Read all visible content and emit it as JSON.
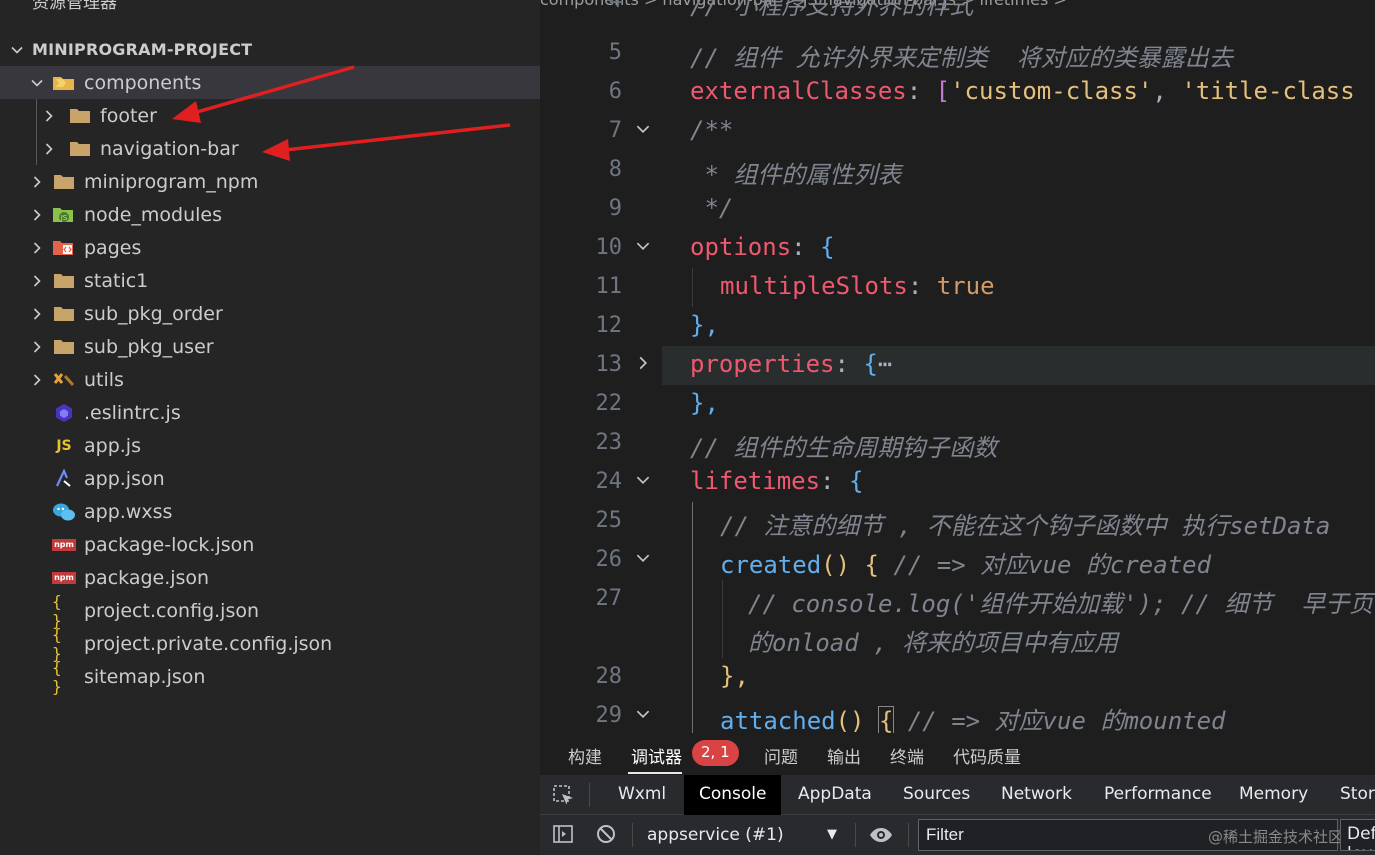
{
  "explorer": {
    "title": "资源管理器",
    "more": "···",
    "root": "MINIPROGRAM-PROJECT",
    "items": [
      {
        "label": "components",
        "icon": "components-folder-icon"
      },
      {
        "label": "footer",
        "icon": "folder-icon"
      },
      {
        "label": "navigation-bar",
        "icon": "folder-icon"
      },
      {
        "label": "miniprogram_npm",
        "icon": "folder-icon"
      },
      {
        "label": "node_modules",
        "icon": "node-folder-icon"
      },
      {
        "label": "pages",
        "icon": "pages-folder-icon"
      },
      {
        "label": "static1",
        "icon": "folder-icon"
      },
      {
        "label": "sub_pkg_order",
        "icon": "folder-icon"
      },
      {
        "label": "sub_pkg_user",
        "icon": "folder-icon"
      },
      {
        "label": "utils",
        "icon": "utils-folder-icon"
      },
      {
        "label": ".eslintrc.js",
        "icon": "eslint-icon"
      },
      {
        "label": "app.js",
        "icon": "js-icon",
        "badge": "JS"
      },
      {
        "label": "app.json",
        "icon": "app-json-icon"
      },
      {
        "label": "app.wxss",
        "icon": "wxss-icon"
      },
      {
        "label": "package-lock.json",
        "icon": "npm-icon",
        "badge": "npm"
      },
      {
        "label": "package.json",
        "icon": "npm-icon",
        "badge": "npm"
      },
      {
        "label": "project.config.json",
        "icon": "json-icon",
        "badge": "{ }"
      },
      {
        "label": "project.private.config.json",
        "icon": "json-icon",
        "badge": "{ }"
      },
      {
        "label": "sitemap.json",
        "icon": "json-icon",
        "badge": "{ }"
      }
    ]
  },
  "editor": {
    "breadcrumb": "components > navigation-bar > JS navigation-bar.js > lifetimes > ",
    "lines": {
      "l4": {
        "num": "4",
        "comment": "// 小程序支持外界的样式"
      },
      "l5": {
        "num": "5",
        "comment": "// 组件 允许外界来定制类  将对应的类暴露出去"
      },
      "l6": {
        "num": "6",
        "key": "externalClasses",
        "colon": ":",
        "open": "[",
        "s1": "'custom-class'",
        "comma": ",",
        "s2": "'title-class"
      },
      "l7": {
        "num": "7",
        "comment": "/**"
      },
      "l8": {
        "num": "8",
        "comment": " * 组件的属性列表"
      },
      "l9": {
        "num": "9",
        "comment": " */"
      },
      "l10": {
        "num": "10",
        "key": "options",
        "colon": ":",
        "open": "{"
      },
      "l11": {
        "num": "11",
        "key": "multipleSlots",
        "colon": ":",
        "value": "true"
      },
      "l12": {
        "num": "12",
        "close": "},"
      },
      "l13": {
        "num": "13",
        "key": "properties",
        "colon": ":",
        "open": "{",
        "ellipsis": "⋯"
      },
      "l22": {
        "num": "22",
        "close": "},"
      },
      "l23": {
        "num": "23",
        "comment": "// 组件的生命周期钩子函数"
      },
      "l24": {
        "num": "24",
        "key": "lifetimes",
        "colon": ":",
        "open": "{"
      },
      "l25": {
        "num": "25",
        "comment": "// 注意的细节 , 不能在这个钩子函数中 执行setData"
      },
      "l26": {
        "num": "26",
        "fn": "created",
        "parens": "()",
        "open": "{",
        "comment": "// => 对应vue 的created"
      },
      "l27": {
        "num": "27",
        "comment": "// console.log('组件开始加载'); // 细节  早于页面",
        "comment2": "的onload , 将来的项目中有应用"
      },
      "l28": {
        "num": "28",
        "close": "},"
      },
      "l29": {
        "num": "29",
        "fn": "attached",
        "parens": "()",
        "open": "{",
        "comment": "// => 对应vue 的mounted"
      }
    }
  },
  "panel": {
    "tabs": [
      "构建",
      "调试器",
      "问题",
      "输出",
      "终端",
      "代码质量"
    ],
    "badge": "2, 1",
    "devtools_tabs": [
      "Wxml",
      "Console",
      "AppData",
      "Sources",
      "Network",
      "Performance",
      "Memory",
      "Storage"
    ],
    "context": "appservice (#1)",
    "filter_placeholder": "Filter",
    "levels": "Default levels",
    "watermark": "@稀土掘金技术社区"
  }
}
